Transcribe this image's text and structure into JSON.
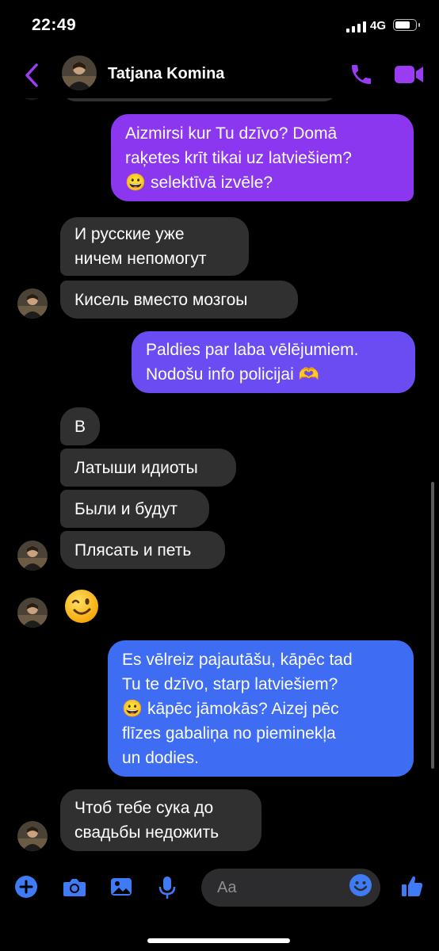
{
  "status_bar": {
    "time": "22:49",
    "network": "4G"
  },
  "header": {
    "contact_name": "Tatjana Komina"
  },
  "messages": [
    {
      "lines": [
        "Aizmirsi kur Tu dzīvo? Domā",
        "raķetes krīt tikai uz latviešiem?",
        "😀 selektīvā izvēle?"
      ]
    },
    {
      "lines": [
        "И русские уже",
        "ничем непомогут"
      ]
    },
    {
      "lines": [
        "Кисель вместо мозгоы"
      ]
    },
    {
      "lines": [
        "Paldies par laba vēlējumiem.",
        "Nodošu info policijai 🫶"
      ]
    },
    {
      "lines": [
        "В"
      ]
    },
    {
      "lines": [
        "Латыши идиоты"
      ]
    },
    {
      "lines": [
        "Были и будут"
      ]
    },
    {
      "lines": [
        "Плясать и петь"
      ]
    },
    {
      "lines": [
        "Es vēlreiz pajautāšu, kāpēc tad",
        "Tu te dzīvo, starp latviešiem?",
        "😀 kāpēc jāmokās? Aizej pēc",
        "flīzes gabaliņa no pieminekļa",
        "un dodies."
      ]
    },
    {
      "lines": [
        "Чтоб тебе сука до",
        "свадьбы недожить"
      ]
    }
  ],
  "composer": {
    "placeholder": "Aa"
  },
  "colors": {
    "accent": "#9b3cf5",
    "outgoing_top": "#8a37f0",
    "outgoing_bottom": "#3f6ef2",
    "incoming": "#303030"
  }
}
